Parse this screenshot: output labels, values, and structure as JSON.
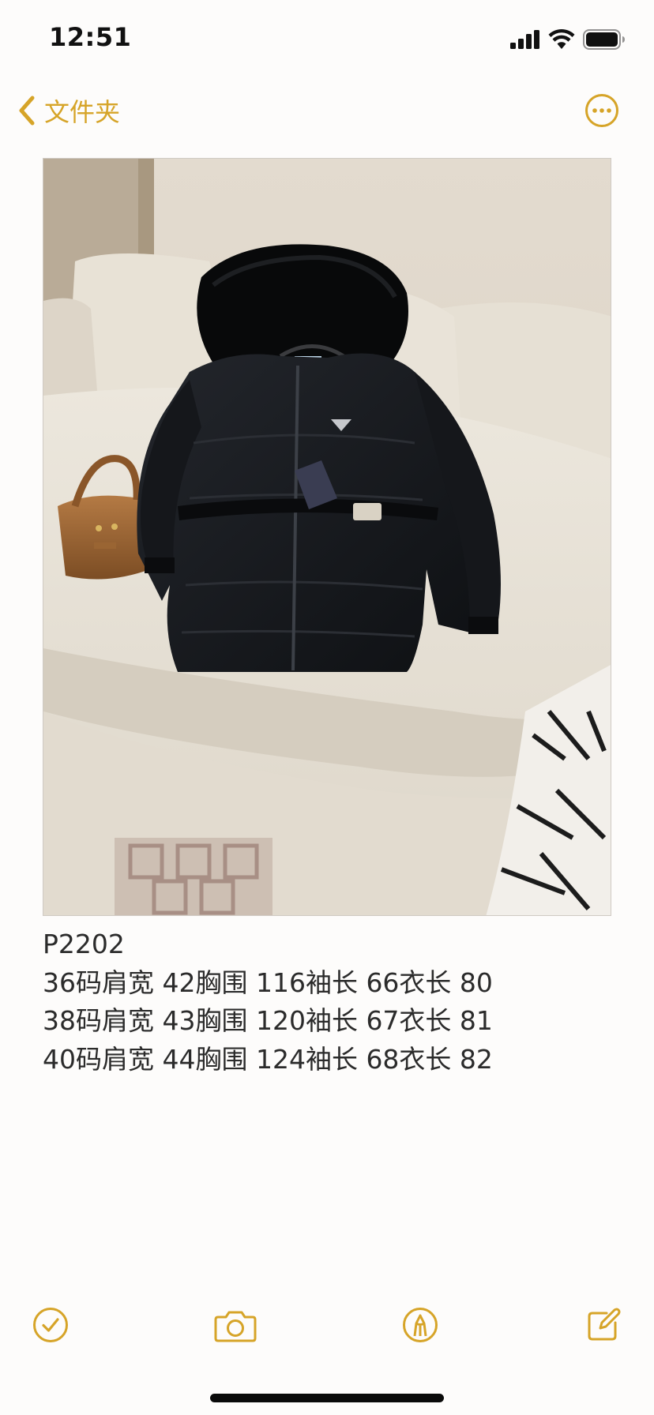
{
  "status_bar": {
    "time": "12:51"
  },
  "nav": {
    "back_label": "文件夹",
    "back_icon": "chevron-left-icon",
    "more_icon": "ellipsis-circle-icon"
  },
  "note": {
    "photo": "black hooded down jacket with fur-trim hood and belt, laid on a cream sofa beside a brown handbag",
    "lines": [
      "P2202",
      "36码肩宽 42胸围 116袖长 66衣长 80",
      "38码肩宽 43胸围 120袖长 67衣长 81",
      "40码肩宽 44胸围 124袖长 68衣长 82"
    ]
  },
  "toolbar": {
    "items": [
      "checklist-icon",
      "camera-icon",
      "markup-pen-icon",
      "compose-icon"
    ]
  },
  "colors": {
    "accent": "#d6a428",
    "background": "#fdfcfb",
    "text": "#2b2b2b"
  }
}
